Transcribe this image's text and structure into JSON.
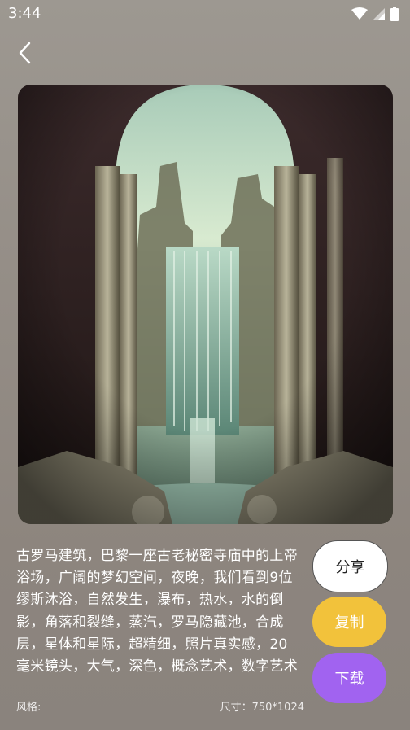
{
  "status_bar": {
    "time": "3:44",
    "icons": [
      "wifi-icon",
      "signal-icon",
      "battery-icon"
    ]
  },
  "header": {
    "back_icon": "chevron-left-icon"
  },
  "artwork": {
    "description_icon": "image"
  },
  "prompt": {
    "text": "古罗马建筑，巴黎一座古老秘密寺庙中的上帝浴场，广阔的梦幻空间，夜晚，我们看到9位缪斯沐浴，自然发生，瀑布，热水，水的倒影，角落和裂缝，蒸汽，罗马隐藏池，合成层，星体和星际，超精细，照片真实感，20毫米镜头，大气，深色，概念艺术，数字艺术"
  },
  "meta": {
    "style_label": "风格:",
    "size_label": "尺寸：750*1024"
  },
  "actions": {
    "share_label": "分享",
    "copy_label": "复制",
    "download_label": "下载"
  },
  "colors": {
    "share_bg": "#ffffff",
    "copy_bg": "#f2c23b",
    "download_bg": "#a163f0"
  }
}
